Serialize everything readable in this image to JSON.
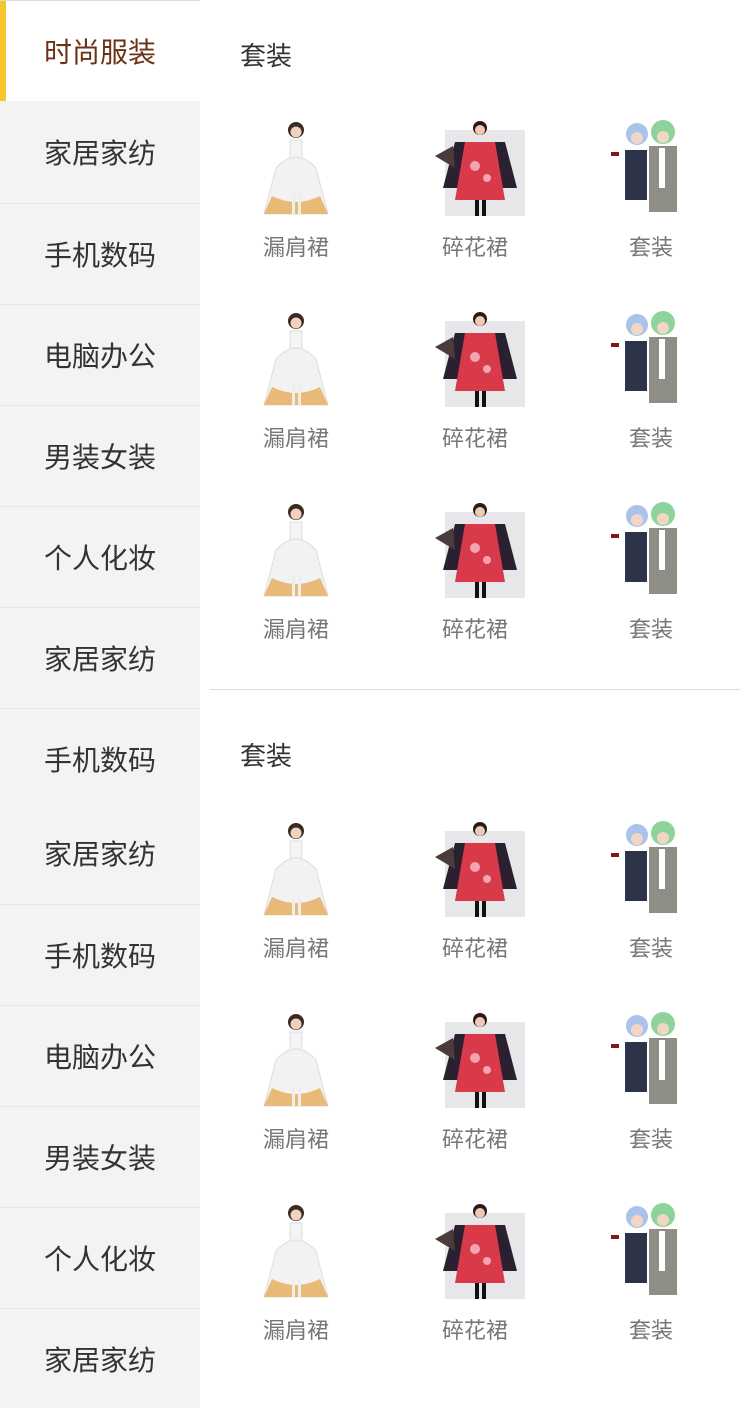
{
  "sidebar": {
    "items": [
      {
        "label": "时尚服装",
        "active": true
      },
      {
        "label": "家居家纺"
      },
      {
        "label": "手机数码"
      },
      {
        "label": "电脑办公"
      },
      {
        "label": "男装女装"
      },
      {
        "label": "个人化妆"
      },
      {
        "label": "家居家纺"
      },
      {
        "label": "手机数码"
      },
      {
        "label": "家居家纺"
      },
      {
        "label": "手机数码"
      },
      {
        "label": "电脑办公"
      },
      {
        "label": "男装女装"
      },
      {
        "label": "个人化妆"
      },
      {
        "label": "家居家纺"
      }
    ],
    "active_accent_color": "#f5c52a",
    "active_text_color": "#6a3316"
  },
  "sections": [
    {
      "title": "套装",
      "products": [
        {
          "name": "漏肩裙",
          "icon": "white-dress-photo"
        },
        {
          "name": "碎花裙",
          "icon": "floral-kimono-photo"
        },
        {
          "name": "套装",
          "icon": "school-uniform-photo"
        },
        {
          "name": "漏肩裙",
          "icon": "white-dress-photo"
        },
        {
          "name": "碎花裙",
          "icon": "floral-kimono-photo"
        },
        {
          "name": "套装",
          "icon": "school-uniform-photo"
        },
        {
          "name": "漏肩裙",
          "icon": "white-dress-photo"
        },
        {
          "name": "碎花裙",
          "icon": "floral-kimono-photo"
        },
        {
          "name": "套装",
          "icon": "school-uniform-photo"
        }
      ]
    },
    {
      "title": "套装",
      "products": [
        {
          "name": "漏肩裙",
          "icon": "white-dress-photo"
        },
        {
          "name": "碎花裙",
          "icon": "floral-kimono-photo"
        },
        {
          "name": "套装",
          "icon": "school-uniform-photo"
        },
        {
          "name": "漏肩裙",
          "icon": "white-dress-photo"
        },
        {
          "name": "碎花裙",
          "icon": "floral-kimono-photo"
        },
        {
          "name": "套装",
          "icon": "school-uniform-photo"
        },
        {
          "name": "漏肩裙",
          "icon": "white-dress-photo"
        },
        {
          "name": "碎花裙",
          "icon": "floral-kimono-photo"
        },
        {
          "name": "套装",
          "icon": "school-uniform-photo"
        }
      ]
    }
  ]
}
